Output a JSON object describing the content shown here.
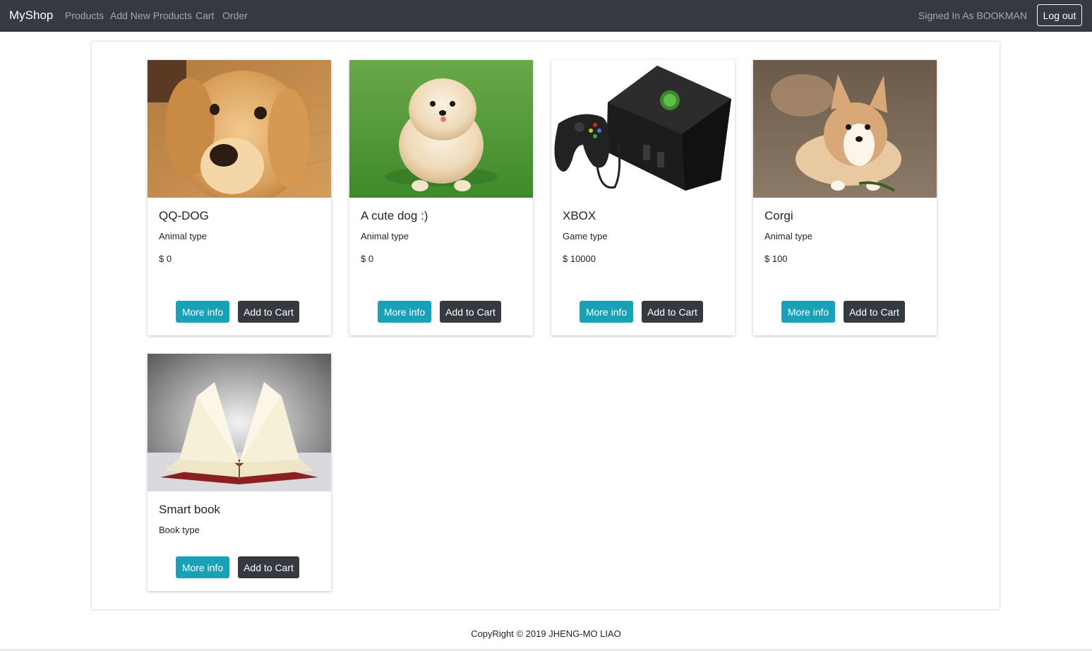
{
  "navbar": {
    "brand": "MyShop",
    "links": [
      "Products",
      "Add New Products",
      "Cart",
      "Order"
    ],
    "signed_in": "Signed In As BOOKMAN",
    "logout_label": "Log out"
  },
  "products": [
    {
      "title": "QQ-DOG",
      "type": "Animal type",
      "price": "$ 0",
      "more_label": "More info",
      "cart_label": "Add to Cart",
      "image": "golden-retriever-photo"
    },
    {
      "title": "A cute dog :)",
      "type": "Animal type",
      "price": "$ 0",
      "more_label": "More info",
      "cart_label": "Add to Cart",
      "image": "pomeranian-photo"
    },
    {
      "title": "XBOX",
      "type": "Game type",
      "price": "$ 10000",
      "more_label": "More info",
      "cart_label": "Add to Cart",
      "image": "xbox-console-photo"
    },
    {
      "title": "Corgi",
      "type": "Animal type",
      "price": "$ 100",
      "more_label": "More info",
      "cart_label": "Add to Cart",
      "image": "corgi-puppy-photo"
    },
    {
      "title": "Smart book",
      "type": "Book type",
      "more_label": "More info",
      "cart_label": "Add to Cart",
      "image": "open-book-photo"
    }
  ],
  "footer": {
    "text": "CopyRight © 2019 JHENG-MO LIAO"
  },
  "colors": {
    "navbar": "#343a40",
    "info": "#17a2b8",
    "dark": "#343a40"
  }
}
